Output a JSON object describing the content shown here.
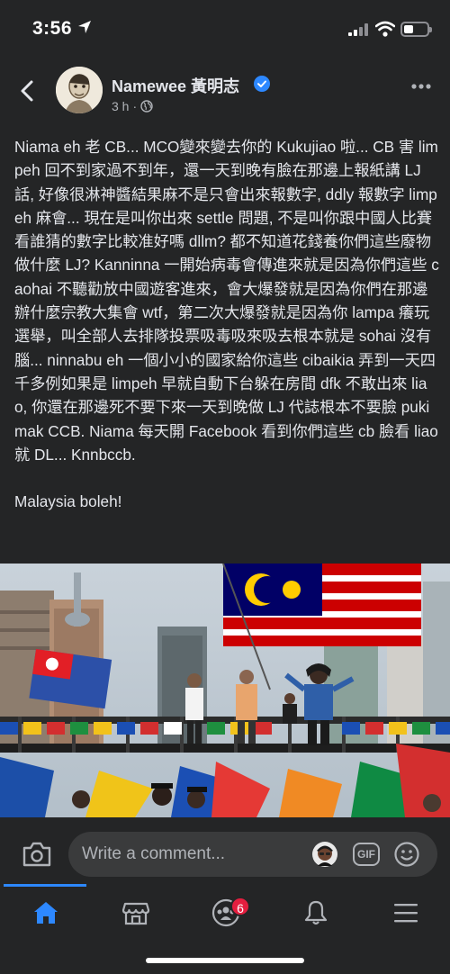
{
  "status_bar": {
    "time": "3:56"
  },
  "post": {
    "author": "Namewee 黃明志",
    "time_ago": "3 h",
    "separator": "·",
    "body": "Niama eh 老 CB... MCO變來變去你的 Kukujiao 啦... CB 害 limpeh 回不到家過不到年，還一天到晚有臉在那邊上報紙講 LJ 話, 好像很淋神醬結果麻不是只會出來報數字, ddly 報數字 limpeh 麻會... 現在是叫你出來 settle 問題, 不是叫你跟中國人比賽看誰猜的數字比較准好嗎 dllm? 都不知道花錢養你們這些廢物做什麼 LJ? Kanninna 一開始病毒會傳進來就是因為你們這些 caohai 不聽勸放中國遊客進來，會大爆發就是因為你們在那邊辦什麼宗教大集會 wtf，第二次大爆發就是因為你 lampa 癢玩選舉，叫全部人去排隊投票吸毒吸來吸去根本就是 sohai 沒有腦... ninnabu eh 一個小小的國家給你這些 cibaikia 弄到一天四千多例如果是 limpeh 早就自動下台躲在房間 dfk 不敢出來 liao, 你還在那邊死不要下來一天到晚做 LJ 代誌根本不要臉 pukimak CCB. Niama 每天開 Facebook 看到你們這些 cb 臉看 liao 就 DL... Knnbccb.",
    "closing": "Malaysia boleh!"
  },
  "comment_bar": {
    "placeholder": "Write a comment...",
    "gif_label": "GIF"
  },
  "bottom_nav": {
    "items": [
      {
        "name": "home",
        "active": true
      },
      {
        "name": "marketplace",
        "active": false
      },
      {
        "name": "groups",
        "active": false,
        "badge": "6"
      },
      {
        "name": "notifications",
        "active": false
      },
      {
        "name": "menu",
        "active": false
      }
    ]
  },
  "colors": {
    "background": "#242526",
    "accent": "#2d88ff",
    "verified": "#2d88ff",
    "badge": "#e41e3f"
  }
}
